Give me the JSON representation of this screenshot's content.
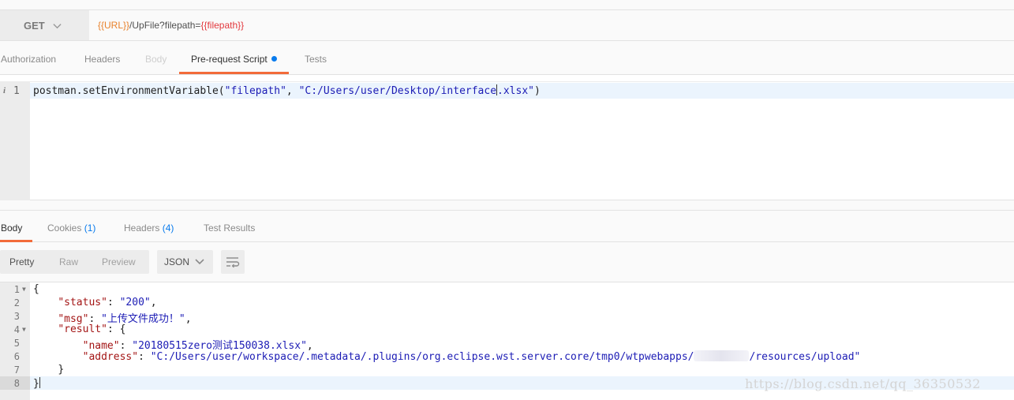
{
  "request": {
    "method": "GET",
    "url": {
      "part1": "{{URL}}",
      "part2": "/UpFile?filepath=",
      "part3": "{{filepath}}"
    }
  },
  "request_tabs": {
    "authorization": "Authorization",
    "headers": "Headers",
    "body": "Body",
    "prerequest": "Pre-request Script",
    "tests": "Tests"
  },
  "script": {
    "line_number": "1",
    "code_prefix": "postman.setEnvironmentVariable(",
    "arg1": "\"filepath\"",
    "sep": ", ",
    "arg2_a": "\"C:/Users/user/Desktop/interface",
    "arg2_b": ".xlsx\"",
    "code_suffix": ")"
  },
  "response_tabs": {
    "body": "Body",
    "cookies": "Cookies",
    "cookies_count": "(1)",
    "headers": "Headers",
    "headers_count": "(4)",
    "test_results": "Test Results"
  },
  "format_bar": {
    "pretty": "Pretty",
    "raw": "Raw",
    "preview": "Preview",
    "format": "JSON"
  },
  "response": {
    "line_numbers": [
      "1",
      "2",
      "3",
      "4",
      "5",
      "6",
      "7",
      "8"
    ],
    "l1": "{",
    "l2_key": "\"status\"",
    "l2_val": "\"200\"",
    "l3_key": "\"msg\"",
    "l3_val": "\"上传文件成功！\"",
    "l4_key": "\"result\"",
    "l4_rest": ": {",
    "l5_key": "\"name\"",
    "l5_val": "\"20180515zero测试150038.xlsx\"",
    "l6_key": "\"address\"",
    "l6_val_a": "\"C:/Users/user/workspace/.metadata/.plugins/org.eclipse.wst.server.core/tmp0/wtpwebapps/",
    "l6_val_b": "/resources/upload\"",
    "l7": "}",
    "l8": "}"
  },
  "watermark": "https://blog.csdn.net/qq_36350532",
  "colors": {
    "accent": "#f26b3a",
    "dot": "#097bed",
    "url_var": "#e8812b",
    "url_var2": "#e2383d",
    "json_key": "#a31515",
    "json_string": "#1c1cb5"
  },
  "icons": [
    "chevron-down-icon",
    "wrap-lines-icon",
    "info-icon",
    "fold-arrow-icon"
  ]
}
